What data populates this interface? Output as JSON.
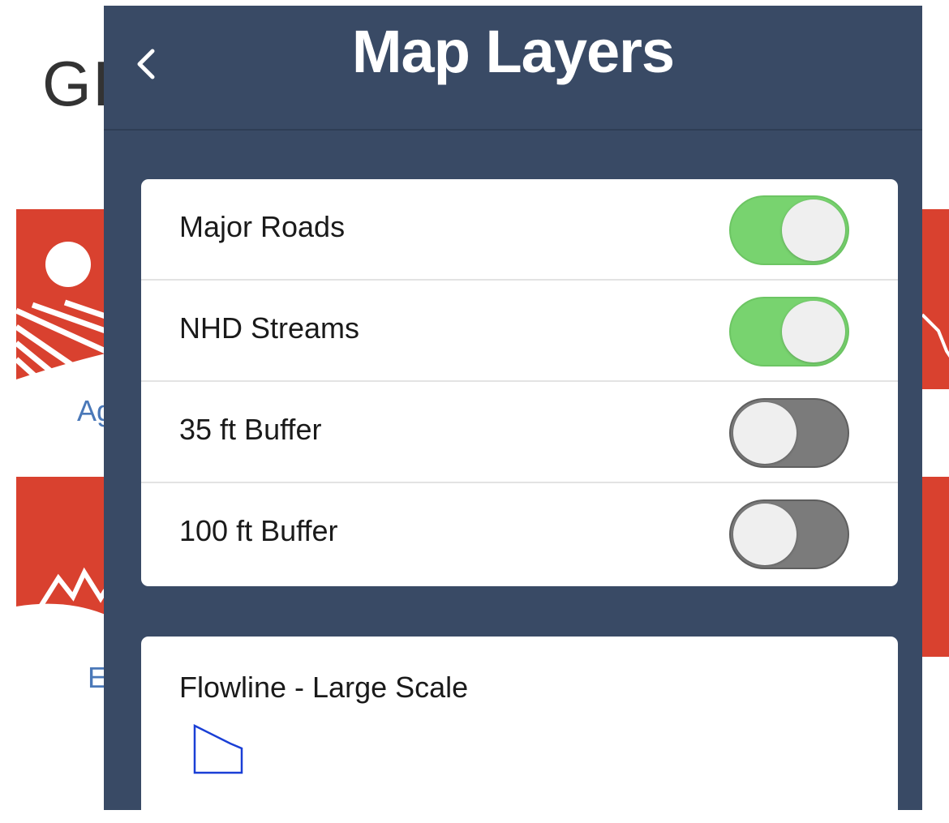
{
  "background": {
    "title_fragment": "GI",
    "tiles": [
      {
        "name": "agriculture",
        "link_fragment": "Ag"
      },
      {
        "name": "elevation",
        "link_fragment": "E"
      }
    ],
    "accent_color": "#d9412f",
    "link_color": "#4a78b8"
  },
  "panel": {
    "title": "Map Layers",
    "back_icon": "chevron-left-icon",
    "background_color": "#394a65",
    "layers": [
      {
        "label": "Major Roads",
        "enabled": true
      },
      {
        "label": "NHD Streams",
        "enabled": true
      },
      {
        "label": "35 ft Buffer",
        "enabled": false
      },
      {
        "label": "100 ft Buffer",
        "enabled": false
      }
    ],
    "toggle_on_color": "#78d36f",
    "toggle_off_color": "#7b7b7b",
    "legend": {
      "title": "Flowline - Large Scale",
      "symbol_icon": "polygon-outline-icon",
      "symbol_color": "#1a3fd6"
    }
  }
}
